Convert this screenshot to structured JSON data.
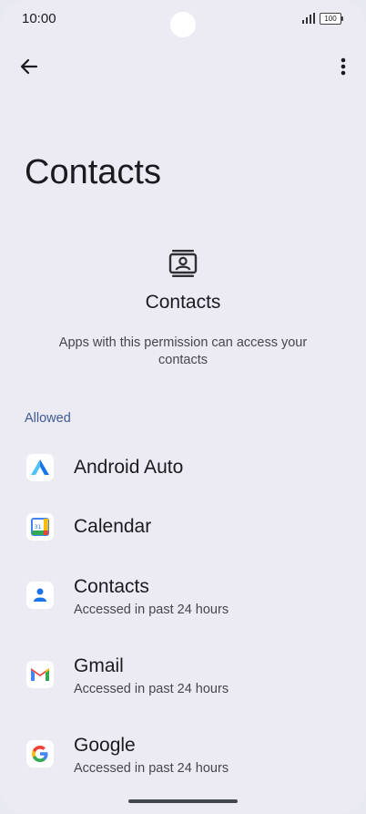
{
  "status_bar": {
    "time": "10:00",
    "battery": "100"
  },
  "toolbar": {
    "back_icon": "arrow-left-icon",
    "more_icon": "more-vert-icon"
  },
  "page": {
    "title": "Contacts"
  },
  "header": {
    "icon": "contacts-permission-icon",
    "title": "Contacts",
    "description": "Apps with this permission can access your contacts"
  },
  "section": {
    "label": "Allowed"
  },
  "apps": [
    {
      "name": "Android Auto",
      "subtitle": "",
      "icon": "android-auto-icon"
    },
    {
      "name": "Calendar",
      "subtitle": "",
      "icon": "calendar-icon"
    },
    {
      "name": "Contacts",
      "subtitle": "Accessed in past 24 hours",
      "icon": "contacts-app-icon"
    },
    {
      "name": "Gmail",
      "subtitle": "Accessed in past 24 hours",
      "icon": "gmail-icon"
    },
    {
      "name": "Google",
      "subtitle": "Accessed in past 24 hours",
      "icon": "google-icon"
    }
  ],
  "colors": {
    "background": "#eceaf3",
    "accent": "#3e5b96"
  }
}
